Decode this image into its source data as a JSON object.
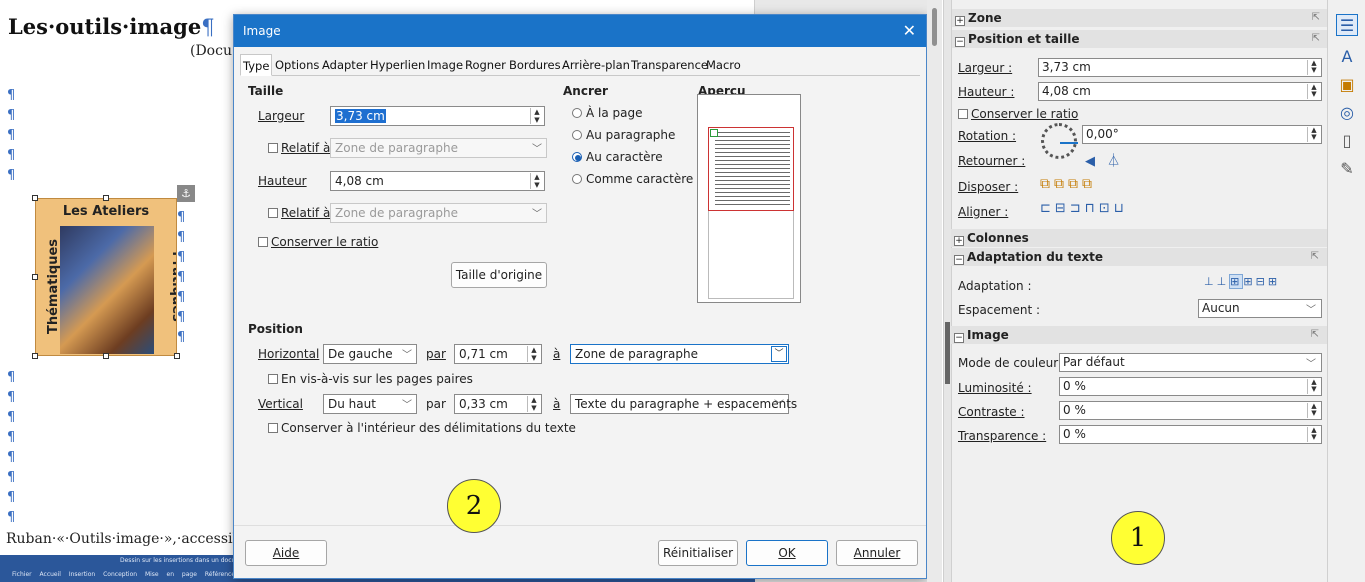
{
  "document": {
    "title": "Les·outils·image",
    "title_pilcrow": "¶",
    "subtitle": "(Docu",
    "pilcrow": "¶",
    "bottom_text": "Ruban·«·Outils·image·»,·accessible",
    "image_top_text": "Les Ateliers",
    "image_left_text": "Thématiques",
    "image_right_text": "Pratiques",
    "anchor_glyph": "⚓",
    "ribbon_line1": "Dessin sur les insertions dans un document",
    "ribbon_line2": "Fichier Accueil Insertion Conception Mise en page Références Pub"
  },
  "dialog": {
    "title": "Image",
    "close_glyph": "✕",
    "tabs": [
      "Type",
      "Options",
      "Adapter",
      "Hyperlien",
      "Image",
      "Rogner",
      "Bordures",
      "Arrière-plan",
      "Transparence",
      "Macro"
    ],
    "taille": {
      "header": "Taille",
      "largeur_label": "Largeur",
      "largeur_value": "3,73 cm",
      "relatif_label": "Relatif à",
      "relatif_value": "Zone de paragraphe",
      "hauteur_label": "Hauteur",
      "hauteur_value": "4,08 cm",
      "relatif2_label": "Relatif à",
      "relatif2_value": "Zone de paragraphe",
      "ratio_label": "Conserver le ratio",
      "origin_button": "Taille d'origine"
    },
    "ancrer": {
      "header": "Ancrer",
      "options": [
        "À la page",
        "Au paragraphe",
        "Au caractère",
        "Comme caractère"
      ],
      "selected": 2
    },
    "apercu": {
      "header": "Aperçu"
    },
    "position": {
      "header": "Position",
      "horizontal_label": "Horizontal",
      "horizontal_value": "De gauche",
      "par_label": "par",
      "horizontal_by": "0,71 cm",
      "a_label": "à",
      "horizontal_to": "Zone de paragraphe",
      "mirror_label": "En vis-à-vis sur les pages paires",
      "vertical_label": "Vertical",
      "vertical_value": "Du haut",
      "vertical_by": "0,33 cm",
      "vertical_to": "Texte du paragraphe + espacements",
      "keep_inside_label": "Conserver à l'intérieur des délimitations du texte"
    },
    "footer": {
      "help": "Aide",
      "reset": "Réinitialiser",
      "ok": "OK",
      "cancel": "Annuler"
    }
  },
  "sidebar": {
    "zone": "Zone",
    "pos_taille": "Position et taille",
    "largeur_label": "Largeur :",
    "largeur_value": "3,73 cm",
    "hauteur_label": "Hauteur :",
    "hauteur_value": "4,08 cm",
    "ratio_label": "Conserver le ratio",
    "rotation_label": "Rotation :",
    "rotation_value": "0,00°",
    "retourner_label": "Retourner :",
    "retourner_icons": "◀ ⏃",
    "disposer_label": "Disposer :",
    "aligner_label": "Aligner :",
    "colonnes": "Colonnes",
    "adaptation_section": "Adaptation du texte",
    "adaptation_label": "Adaptation :",
    "espacement_label": "Espacement :",
    "espacement_value": "Aucun",
    "image_section": "Image",
    "couleur_label": "Mode de couleur :",
    "couleur_value": "Par défaut",
    "luminosite_label": "Luminosité :",
    "luminosite_value": "0 %",
    "contraste_label": "Contraste :",
    "contraste_value": "0 %",
    "transparence_label": "Transparence :",
    "transparence_value": "0 %"
  },
  "callouts": {
    "one": "1",
    "two": "2"
  },
  "colors": {
    "accent": "#1a73c8",
    "callout": "#ffff33",
    "pilcrow": "#3a6fc2"
  }
}
